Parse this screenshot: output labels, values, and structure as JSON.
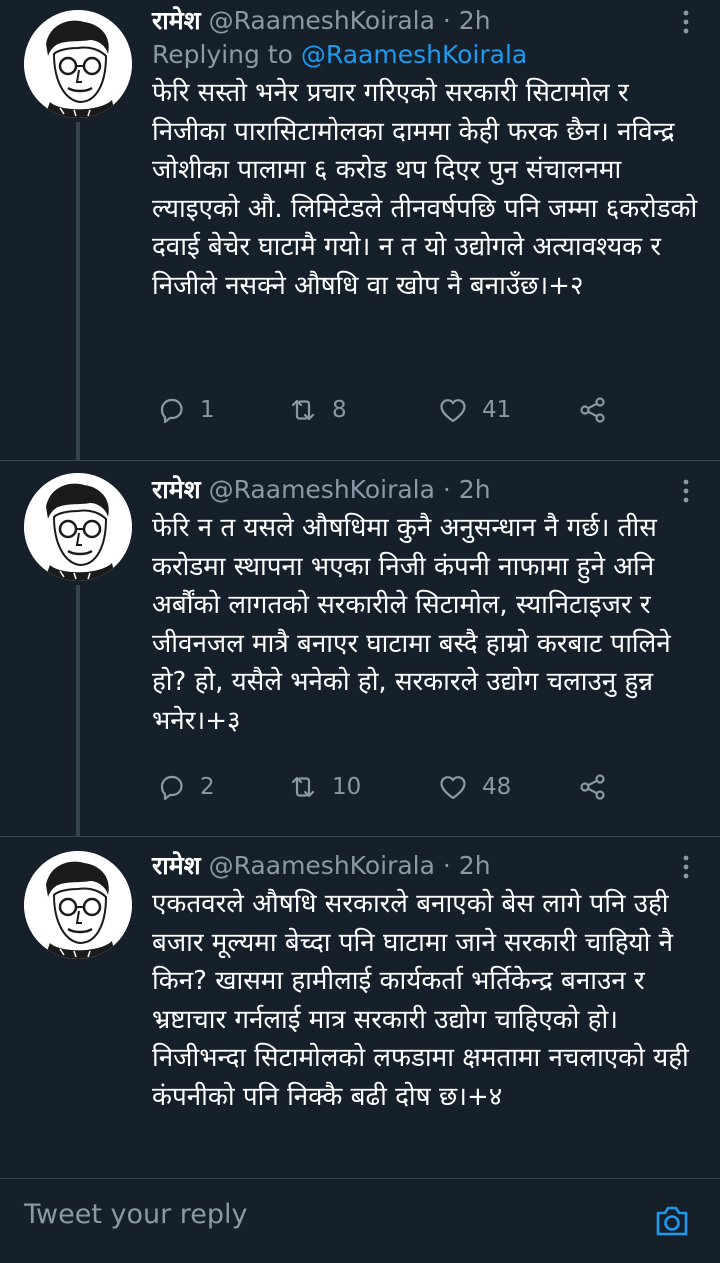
{
  "tweets": [
    {
      "name": "रामेश",
      "handle": "@RaameshKoirala",
      "separator": "·",
      "time": "2h",
      "replying_label": "Replying to ",
      "replying_to": "@RaameshKoirala",
      "text": "फेरि सस्तो भनेर प्रचार गरिएको सरकारी सिटामोल र निजीका पारासिटामोलका दाममा केही फरक छैन। नविन्द्र जोशीका पालामा ६ करोड थप दिएर पुन संचालनमा ल्याइएको औ. लिमिटेडले तीनवर्षपछि पनि जम्मा ६करोडको दवाई बेचेर घाटामै गयो। न त यो उद्योगले अत्यावश्यक र निजीले नसक्ने औषधि वा खोप नै बनाउँछ।+२",
      "replies": "1",
      "retweets": "8",
      "likes": "41"
    },
    {
      "name": "रामेश",
      "handle": "@RaameshKoirala",
      "separator": "·",
      "time": "2h",
      "text": "फेरि न त यसले औषधिमा कुनै अनुसन्धान नै गर्छ। तीस करोडमा स्थापना भएका निजी कंपनी नाफामा हुने अनि अर्बौंको लागतको सरकारीले सिटामोल, स्यानिटाइजर र जीवनजल मात्रै बनाएर घाटामा बस्दै हाम्रो करबाट पालिने हो? हो, यसैले भनेको हो, सरकारले उद्योग चलाउनु हुन्न भनेर।+३",
      "replies": "2",
      "retweets": "10",
      "likes": "48"
    },
    {
      "name": "रामेश",
      "handle": "@RaameshKoirala",
      "separator": "·",
      "time": "2h",
      "text": "एकतवरले औषधि सरकारले बनाएको बेस लागे पनि उही बजार मूल्यमा बेच्दा पनि घाटामा जाने सरकारी चाहियो नै किन? खासमा हामीलाई कार्यकर्ता भर्तिकेन्द्र बनाउन र भ्रष्टाचार गर्नलाई मात्र सरकारी उद्योग चाहिएको हो। निजीभन्दा सिटामोलको लफडामा क्षमतामा नचलाएको यही कंपनीको पनि निक्कै बढी दोष छ।+४"
    }
  ],
  "composer": {
    "placeholder": "Tweet your reply"
  },
  "colors": {
    "background": "#15202b",
    "muted": "#8b98a5",
    "accent": "#1d9bf0",
    "divider": "#38444d"
  },
  "icons": {
    "reply": "reply-icon",
    "retweet": "retweet-icon",
    "like": "heart-icon",
    "share": "share-icon",
    "more": "more-vertical-icon",
    "camera": "camera-icon"
  }
}
